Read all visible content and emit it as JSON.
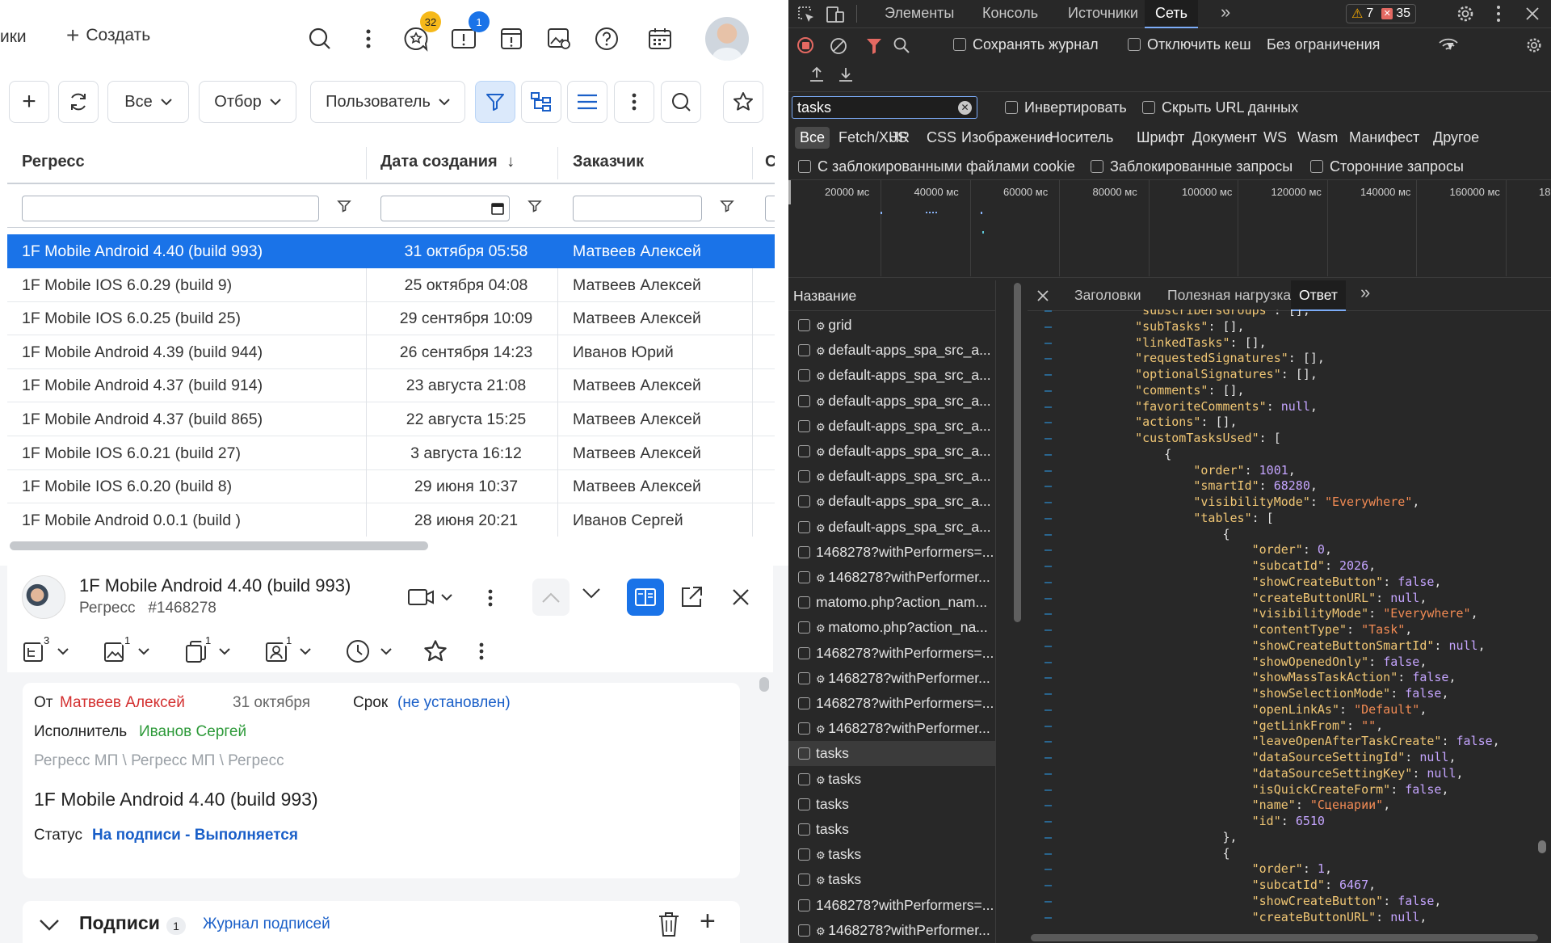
{
  "app": {
    "topbar": {
      "left_cut_label": "ики",
      "create_label": "Создать",
      "badges": {
        "mentions": "32",
        "notifications": "1"
      }
    },
    "toolbar": {
      "filter_all": "Все",
      "filter_selection": "Отбор",
      "filter_user": "Пользователь"
    },
    "grid": {
      "columns": [
        "Регресс",
        "Дата создания",
        "Заказчик",
        "С"
      ],
      "sort_indicator": "↓",
      "rows": [
        {
          "name": "1F Mobile Android 4.40 (build 993)",
          "date": "31 октября 05:58",
          "customer": "Матвеев Алексей"
        },
        {
          "name": "1F Mobile IOS 6.0.29 (build 9)",
          "date": "25 октября 04:08",
          "customer": "Матвеев Алексей"
        },
        {
          "name": "1F Mobile IOS 6.0.25 (build 25)",
          "date": "29 сентября 10:09",
          "customer": "Матвеев Алексей"
        },
        {
          "name": "1F Mobile Android 4.39 (build 944)",
          "date": "26 сентября 14:23",
          "customer": "Иванов Юрий"
        },
        {
          "name": "1F Mobile Android 4.37 (build 914)",
          "date": "23 августа 21:08",
          "customer": "Матвеев Алексей"
        },
        {
          "name": "1F Mobile Android 4.37 (build 865)",
          "date": "22 августа 15:25",
          "customer": "Матвеев Алексей"
        },
        {
          "name": "1F Mobile IOS 6.0.21 (build 27)",
          "date": "3 августа 16:12",
          "customer": "Матвеев Алексей"
        },
        {
          "name": "1F Mobile IOS 6.0.20 (build 8)",
          "date": "29 июня 10:37",
          "customer": "Матвеев Алексей"
        },
        {
          "name": "1F Mobile Android 0.0.1 (build )",
          "date": "28 июня 20:21",
          "customer": "Иванов Сергей"
        }
      ]
    },
    "detail": {
      "title": "1F Mobile Android 4.40 (build 993)",
      "type": "Регресс",
      "number": "#1468278",
      "tool_badges": [
        "3",
        "1",
        "1",
        "1"
      ],
      "from_label": "От",
      "from_name": "Матвеев Алексей",
      "from_date": "31 октября",
      "deadline_label": "Срок",
      "deadline_value": "(не установлен)",
      "performer_label": "Исполнитель",
      "performer_name": "Иванов Сергей",
      "path": "Регресс МП \\ Регресс МП \\ Регресс",
      "heading": "1F Mobile Android 4.40 (build 993)",
      "status_label": "Статус",
      "status_value": "На подписи - Выполняется",
      "signatures_title": "Подписи",
      "signatures_count": "1",
      "signatures_log": "Журнал подписей"
    }
  },
  "devtools": {
    "tabs": [
      "Элементы",
      "Консоль",
      "Источники",
      "Сеть"
    ],
    "active_tab": "Сеть",
    "warnings": "7",
    "errors": "35",
    "preserve_log": "Сохранять журнал",
    "disable_cache": "Отключить кеш",
    "throttling": "Без ограничения",
    "search_value": "tasks",
    "invert": "Инвертировать",
    "hide_data_urls": "Скрыть URL данных",
    "type_filters": [
      "Все",
      "Fetch/XHR",
      "JS",
      "CSS",
      "Изображение",
      "Носитель",
      "Шрифт",
      "Документ",
      "WS",
      "Wasm",
      "Манифест",
      "Другое"
    ],
    "blocked_cookies": "С заблокированными файлами cookie",
    "blocked_requests": "Заблокированные запросы",
    "third_party": "Сторонние запросы",
    "timeline_labels": [
      "20000 мс",
      "40000 мс",
      "60000 мс",
      "80000 мс",
      "100000 мс",
      "120000 мс",
      "140000 мс",
      "160000 мс",
      "18"
    ],
    "name_header": "Название",
    "requests": [
      {
        "name": "grid",
        "gear": true
      },
      {
        "name": "default-apps_spa_src_a...",
        "gear": true
      },
      {
        "name": "default-apps_spa_src_a...",
        "gear": true
      },
      {
        "name": "default-apps_spa_src_a...",
        "gear": true
      },
      {
        "name": "default-apps_spa_src_a...",
        "gear": true
      },
      {
        "name": "default-apps_spa_src_a...",
        "gear": true
      },
      {
        "name": "default-apps_spa_src_a...",
        "gear": true
      },
      {
        "name": "default-apps_spa_src_a...",
        "gear": true
      },
      {
        "name": "default-apps_spa_src_a...",
        "gear": true
      },
      {
        "name": "1468278?withPerformers=...",
        "gear": false
      },
      {
        "name": "1468278?withPerformer...",
        "gear": true
      },
      {
        "name": "matomo.php?action_nam...",
        "gear": false
      },
      {
        "name": "matomo.php?action_na...",
        "gear": true
      },
      {
        "name": "1468278?withPerformers=...",
        "gear": false
      },
      {
        "name": "1468278?withPerformer...",
        "gear": true
      },
      {
        "name": "1468278?withPerformers=...",
        "gear": false
      },
      {
        "name": "1468278?withPerformer...",
        "gear": true
      },
      {
        "name": "tasks",
        "gear": false,
        "selected": true
      },
      {
        "name": "tasks",
        "gear": true
      },
      {
        "name": "tasks",
        "gear": false
      },
      {
        "name": "tasks",
        "gear": false
      },
      {
        "name": "tasks",
        "gear": true
      },
      {
        "name": "tasks",
        "gear": true
      },
      {
        "name": "1468278?withPerformers=...",
        "gear": false
      },
      {
        "name": "1468278?withPerformer...",
        "gear": true
      }
    ],
    "detail_tabs": [
      "Заголовки",
      "Полезная нагрузка",
      "Ответ"
    ],
    "active_detail_tab": "Ответ",
    "response_lines": [
      "    \"subscribersGroups\": [],",
      "    \"subTasks\": [],",
      "    \"linkedTasks\": [],",
      "    \"requestedSignatures\": [],",
      "    \"optionalSignatures\": [],",
      "    \"comments\": [],",
      "    \"favoriteComments\": null,",
      "    \"actions\": [],",
      "    \"customTasksUsed\": [",
      "        {",
      "            \"order\": 1001,",
      "            \"smartId\": 68280,",
      "            \"visibilityMode\": \"Everywhere\",",
      "            \"tables\": [",
      "                {",
      "                    \"order\": 0,",
      "                    \"subcatId\": 2026,",
      "                    \"showCreateButton\": false,",
      "                    \"createButtonURL\": null,",
      "                    \"visibilityMode\": \"Everywhere\",",
      "                    \"contentType\": \"Task\",",
      "                    \"showCreateButtonSmartId\": null,",
      "                    \"showOpenedOnly\": false,",
      "                    \"showMassTaskAction\": false,",
      "                    \"showSelectionMode\": false,",
      "                    \"openLinkAs\": \"Default\",",
      "                    \"getLinkFrom\": \"\",",
      "                    \"leaveOpenAfterTaskCreate\": false,",
      "                    \"dataSourceSettingId\": null,",
      "                    \"dataSourceSettingKey\": null,",
      "                    \"isQuickCreateForm\": false,",
      "                    \"name\": \"Сценарии\",",
      "                    \"id\": 6510",
      "                },",
      "                {",
      "                    \"order\": 1,",
      "                    \"subcatId\": 6467,",
      "                    \"showCreateButton\": false,",
      "                    \"createButtonURL\": null,"
    ],
    "colors": {
      "bg": "#282828",
      "accent": "#7cacf8",
      "string": "#f0c674",
      "key": "#f0c674"
    }
  },
  "colors": {
    "selection": "#1a73e8",
    "red_name": "#d32f2f",
    "green_name": "#2e9a3a",
    "link": "#1a73e8"
  }
}
